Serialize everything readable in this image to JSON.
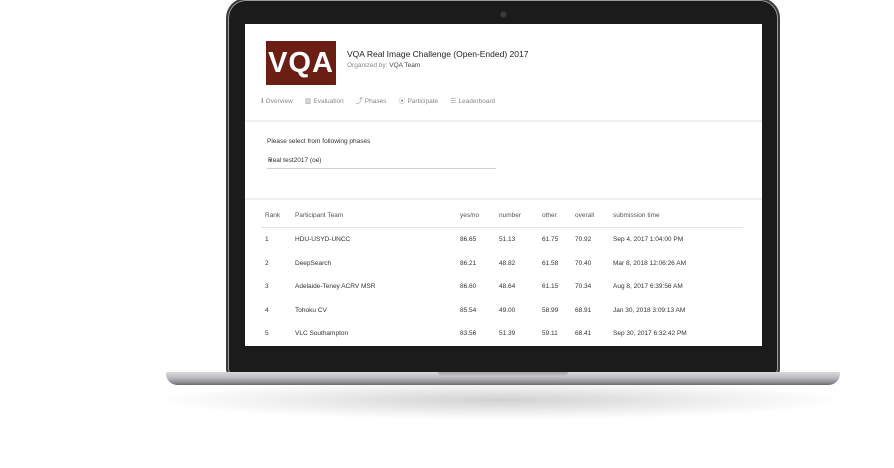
{
  "header": {
    "logo_text": "VQA",
    "title": "VQA Real Image Challenge (Open-Ended) 2017",
    "organizer_prefix": "Organized by:",
    "organizer_name": "VQA Team"
  },
  "tabs": [
    {
      "icon": "info-icon",
      "glyph": "ℹ",
      "label": "Overview"
    },
    {
      "icon": "bar-chart-icon",
      "glyph": "▥",
      "label": "Evaluation"
    },
    {
      "icon": "phases-icon",
      "glyph": "⤴",
      "label": "Phases"
    },
    {
      "icon": "participate-icon",
      "glyph": "⦿",
      "label": "Participate"
    },
    {
      "icon": "list-icon",
      "glyph": "☰",
      "label": "Leaderboard"
    }
  ],
  "phase": {
    "prompt": "Please select from following phases",
    "selected": "Real test2017 (oe)"
  },
  "leaderboard": {
    "columns": [
      "Rank",
      "Participant Team",
      "yes/no",
      "number",
      "other",
      "overall",
      "submission time"
    ],
    "rows": [
      [
        "1",
        "HDU-USYD-UNCC",
        "86.65",
        "51.13",
        "61.75",
        "70.92",
        "Sep 4, 2017 1:04:00 PM"
      ],
      [
        "2",
        "DeepSearch",
        "86.21",
        "48.82",
        "61.58",
        "70.40",
        "Mar 8, 2018 12:06:26 AM"
      ],
      [
        "3",
        "Adelaide-Teney ACRV MSR",
        "86.60",
        "48.64",
        "61.15",
        "70.34",
        "Aug 8, 2017 6:39:56 AM"
      ],
      [
        "4",
        "Tohoku CV",
        "85.54",
        "49.00",
        "58.99",
        "68.91",
        "Jan 30, 2018 3:09:13 AM"
      ],
      [
        "5",
        "VLC Southampton",
        "83.56",
        "51.39",
        "59.11",
        "68.41",
        "Sep 30, 2017 6:32:42 PM"
      ]
    ]
  },
  "colors": {
    "logo_bg": "#6b1f14",
    "laptop_bezel": "#1b1b1c",
    "laptop_base": "#bfbfc3"
  }
}
